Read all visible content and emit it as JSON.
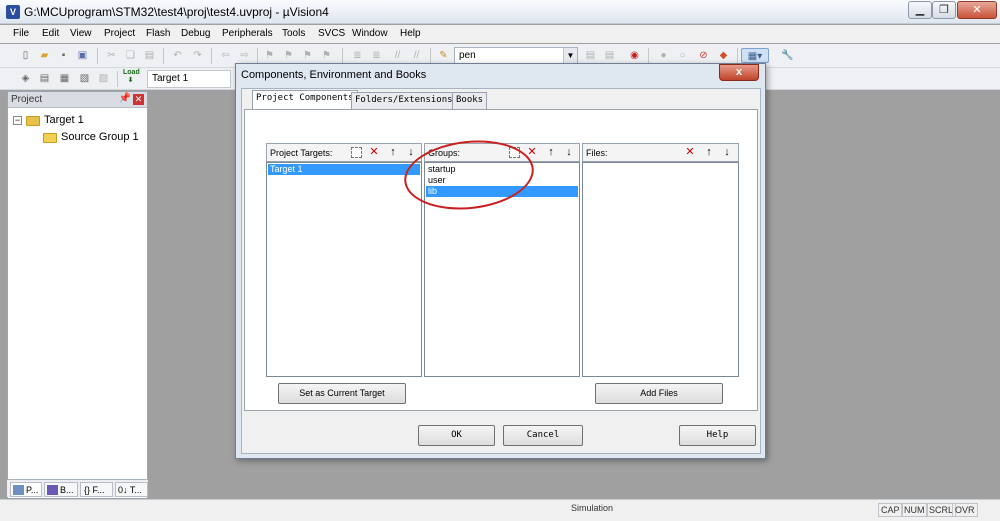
{
  "window": {
    "title": "G:\\MCUprogram\\STM32\\test4\\proj\\test4.uvproj - µVision4",
    "icon": "V",
    "controls": [
      "minimize-icon",
      "restore-icon",
      "close-icon"
    ]
  },
  "menu": [
    "File",
    "Edit",
    "View",
    "Project",
    "Flash",
    "Debug",
    "Peripherals",
    "Tools",
    "SVCS",
    "Window",
    "Help"
  ],
  "toolbar": {
    "find_combo": "pen",
    "target_combo": "Target 1",
    "load_label": "Load"
  },
  "project_panel": {
    "title": "Project",
    "tree": [
      {
        "label": "Target 1",
        "level": 0
      },
      {
        "label": "Source Group 1",
        "level": 1
      }
    ],
    "tabs": [
      "P...",
      "B...",
      "{} F...",
      "0↓ T..."
    ]
  },
  "dialog": {
    "title": "Components, Environment and Books",
    "close_symbol": "x",
    "tabs": [
      "Project Components",
      "Folders/Extensions",
      "Books"
    ],
    "active_tab": 0,
    "targets": {
      "label": "Project Targets:",
      "items": [
        "Target 1"
      ],
      "selected": 0
    },
    "groups": {
      "label": "Groups:",
      "items": [
        "startup",
        "user",
        "lib"
      ],
      "selected": 2
    },
    "files": {
      "label": "Files:",
      "items": []
    },
    "set_current_target_label": "Set as Current Target",
    "add_files_label": "Add Files",
    "ok_label": "OK",
    "cancel_label": "Cancel",
    "help_label": "Help"
  },
  "status": {
    "mode": "Simulation",
    "indicators": [
      "CAP",
      "NUM",
      "SCRL",
      "OVR"
    ]
  },
  "colors": {
    "selection": "#3399ff",
    "annotation": "#c92020"
  }
}
